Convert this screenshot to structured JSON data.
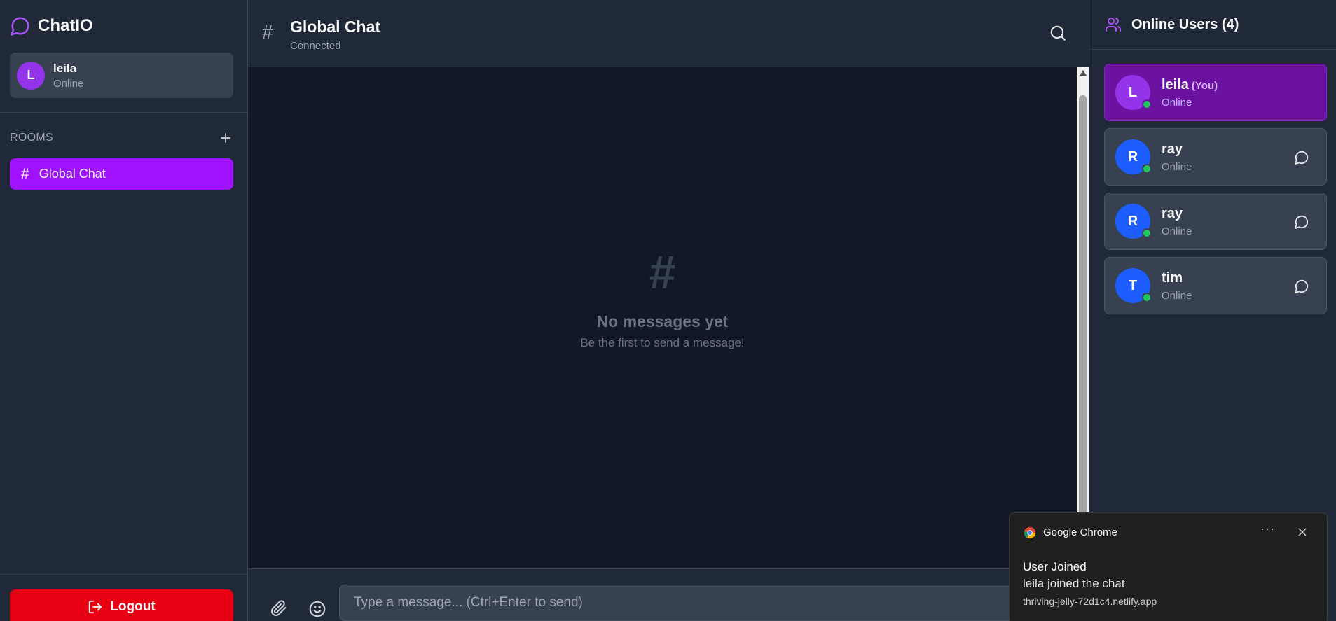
{
  "brand": {
    "name": "ChatIO"
  },
  "current_user": {
    "initial": "L",
    "name": "leila",
    "status": "Online"
  },
  "rooms": {
    "heading": "ROOMS",
    "items": [
      {
        "hash": "#",
        "label": "Global Chat",
        "active": true
      }
    ]
  },
  "logout": {
    "label": "Logout"
  },
  "chat": {
    "hash": "#",
    "title": "Global Chat",
    "status": "Connected",
    "empty": {
      "icon": "#",
      "title": "No messages yet",
      "subtitle": "Be the first to send a message!"
    },
    "input_placeholder": "Type a message... (Ctrl+Enter to send)"
  },
  "online": {
    "title": "Online Users (4)",
    "users": [
      {
        "initial": "L",
        "name": "leila",
        "you_tag": "(You)",
        "status": "Online",
        "color": "#9333ea"
      },
      {
        "initial": "R",
        "name": "ray",
        "status": "Online",
        "color": "#1d5cff"
      },
      {
        "initial": "R",
        "name": "ray",
        "status": "Online",
        "color": "#1d5cff"
      },
      {
        "initial": "T",
        "name": "tim",
        "status": "Online",
        "color": "#1d5cff"
      }
    ]
  },
  "notification": {
    "app": "Google Chrome",
    "more": "···",
    "title": "User Joined",
    "body": "leila joined the chat",
    "origin": "thriving-jelly-72d1c4.netlify.app"
  },
  "colors": {
    "accent": "#a011ff",
    "logout": "#e60012",
    "online_dot": "#22c55e",
    "background": "#111827",
    "panel": "#1f2937"
  }
}
